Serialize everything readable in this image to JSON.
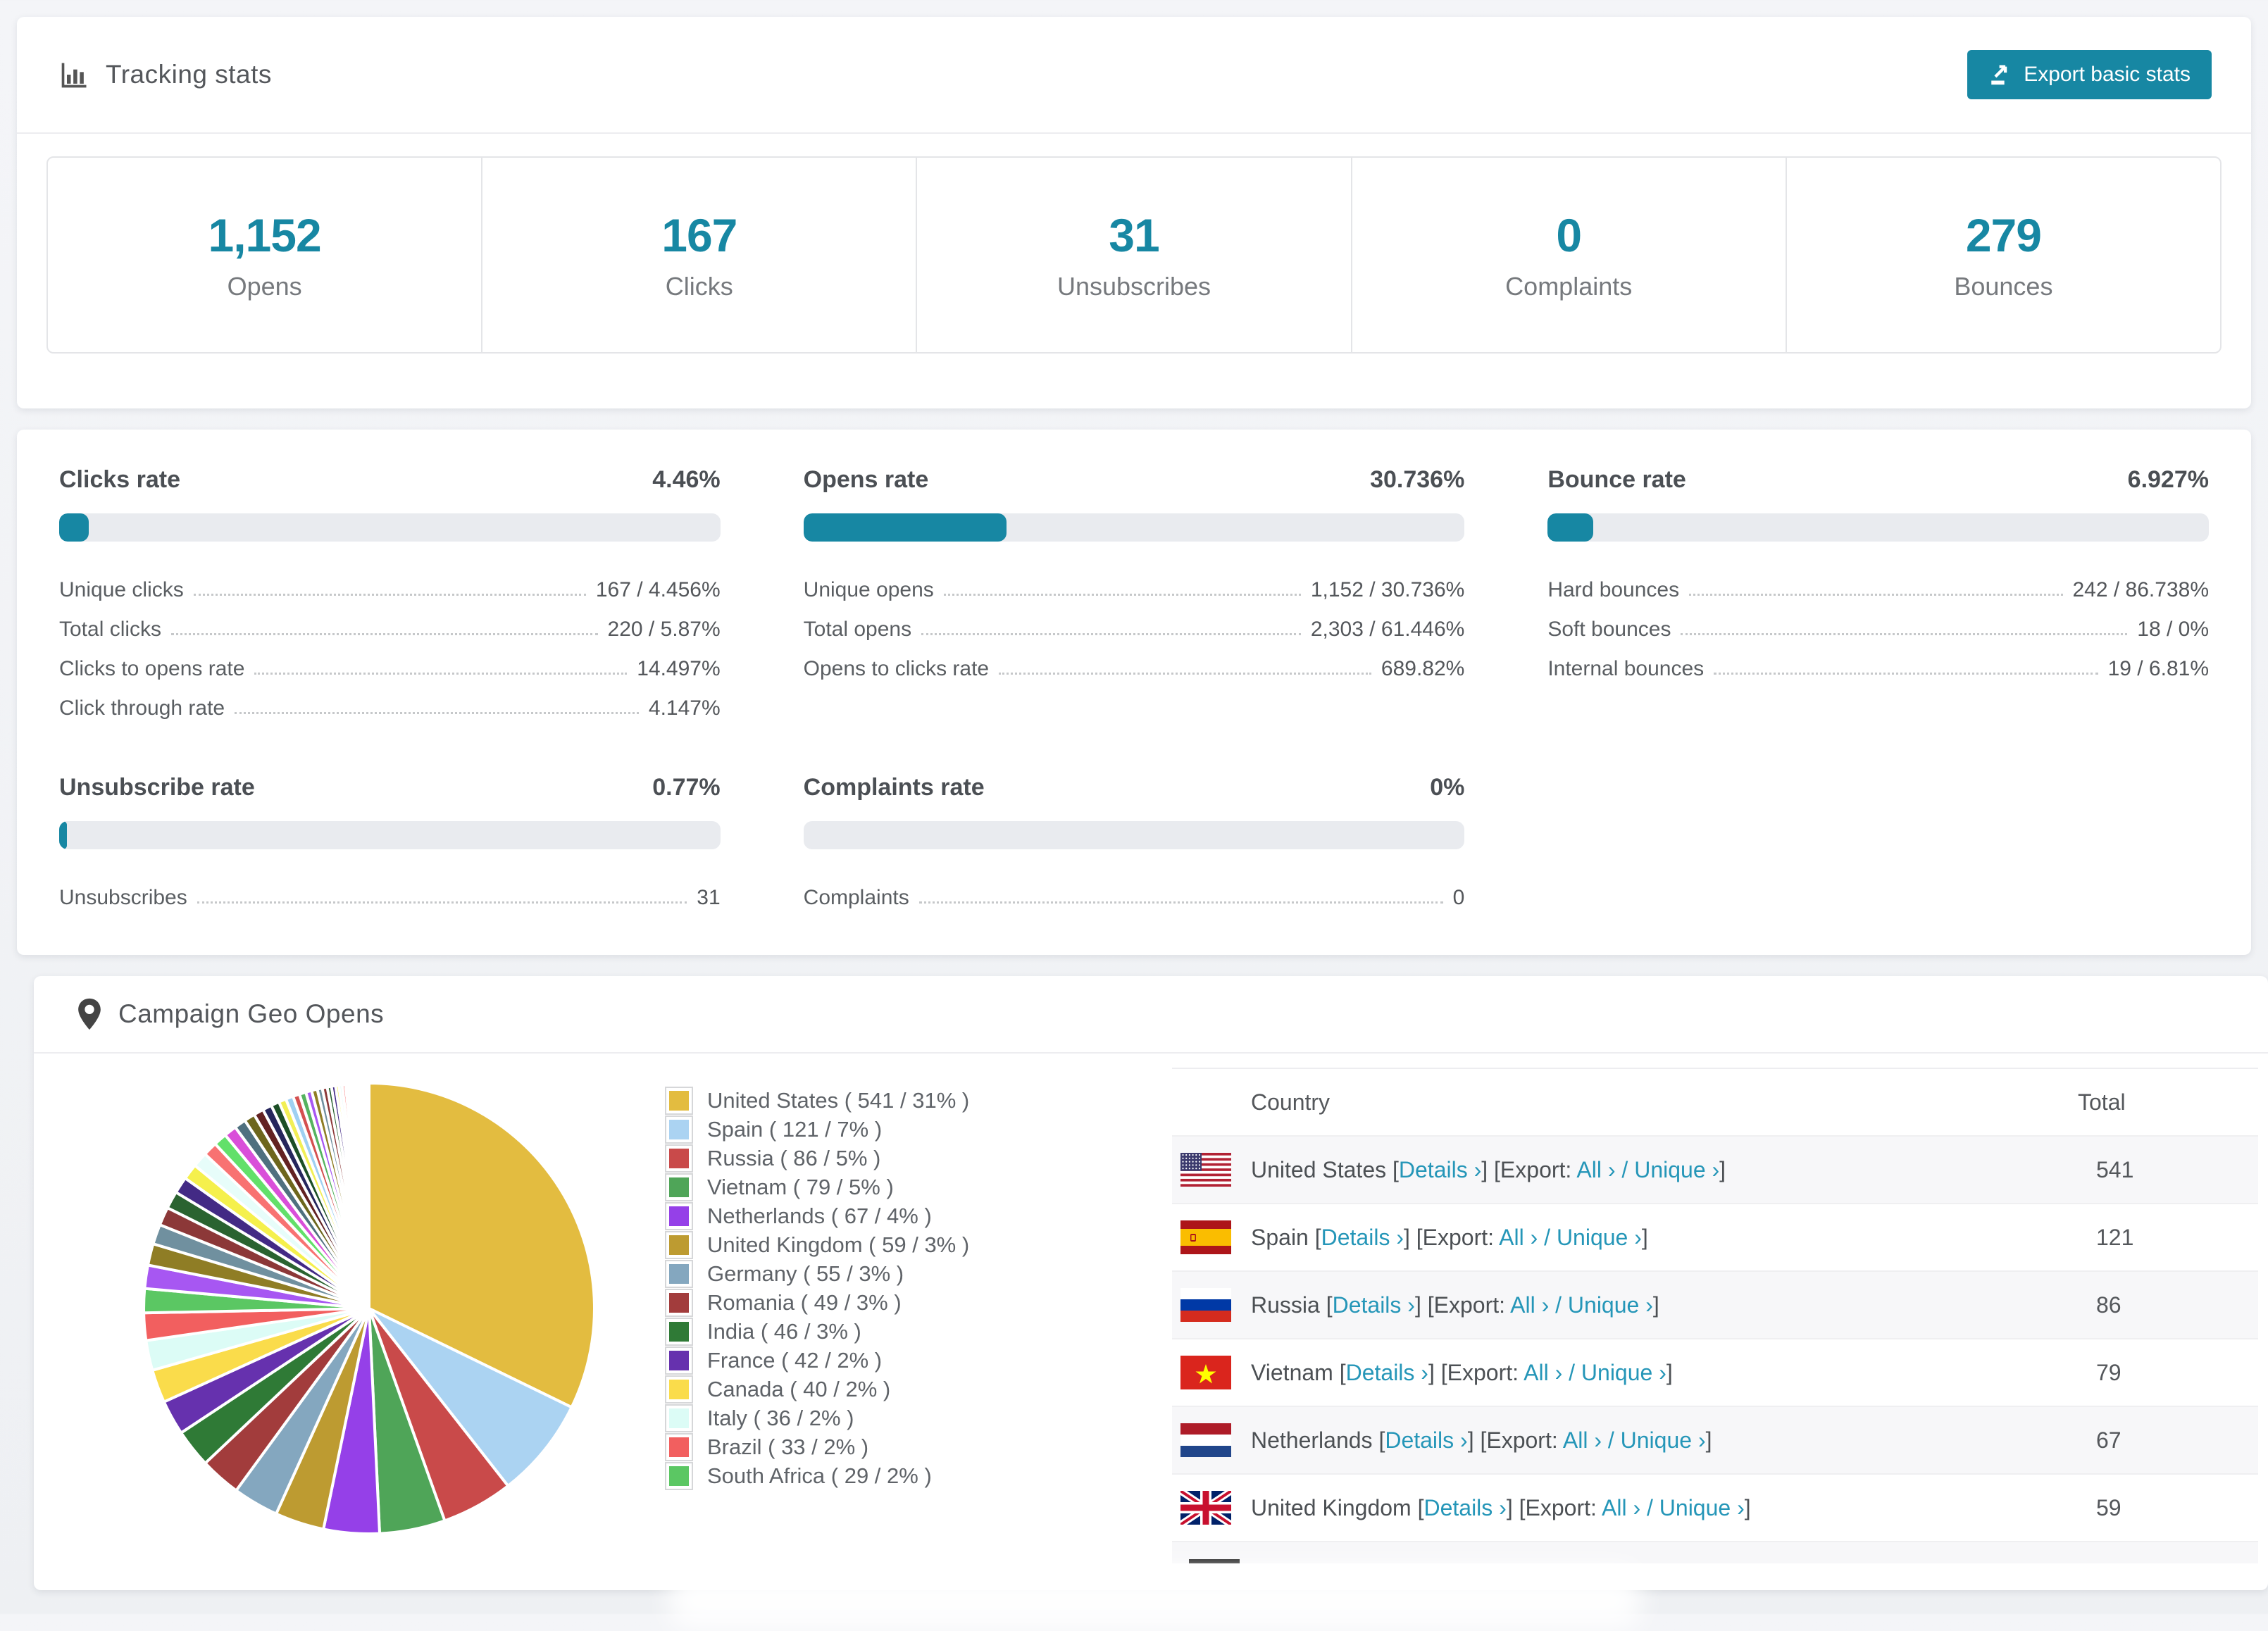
{
  "colors": {
    "accent": "#1787a3",
    "link": "#2596b8",
    "bar_bg": "#e9ebef",
    "swatch_palette": [
      "#e3bc40",
      "#abd3f2",
      "#c94a4a",
      "#4fa558",
      "#9540e8",
      "#bd9b31",
      "#84a7bf",
      "#a23c3c",
      "#2f7a36",
      "#6631ae",
      "#fadc4b",
      "#dcfcf6",
      "#f25f5f",
      "#5bc763"
    ],
    "tail_palette": [
      "#a757f2",
      "#8f7d25",
      "#70909f",
      "#8c3838",
      "#2a6330",
      "#432a85",
      "#f5f04c",
      "#e7fdfa",
      "#f87272",
      "#62e06a",
      "#d94fd9",
      "#4f707f",
      "#6d661d",
      "#632222",
      "#26265c",
      "#1c4f26",
      "#f2ef55",
      "#9fd0f2",
      "#d45050",
      "#55b360"
    ]
  },
  "tracking": {
    "title": "Tracking stats",
    "export_label": "Export basic stats",
    "stats": [
      {
        "value": "1,152",
        "label": "Opens"
      },
      {
        "value": "167",
        "label": "Clicks"
      },
      {
        "value": "31",
        "label": "Unsubscribes"
      },
      {
        "value": "0",
        "label": "Complaints"
      },
      {
        "value": "279",
        "label": "Bounces"
      }
    ]
  },
  "rates": {
    "blocks": [
      {
        "title": "Clicks rate",
        "value": "4.46%",
        "pct": 4.46,
        "rows": [
          [
            "Unique clicks",
            "167 / 4.456%"
          ],
          [
            "Total clicks",
            "220 / 5.87%"
          ],
          [
            "Clicks to opens rate",
            "14.497%"
          ],
          [
            "Click through rate",
            "4.147%"
          ]
        ]
      },
      {
        "title": "Opens rate",
        "value": "30.736%",
        "pct": 30.736,
        "rows": [
          [
            "Unique opens",
            "1,152 / 30.736%"
          ],
          [
            "Total opens",
            "2,303 / 61.446%"
          ],
          [
            "Opens to clicks rate",
            "689.82%"
          ]
        ]
      },
      {
        "title": "Bounce rate",
        "value": "6.927%",
        "pct": 6.927,
        "rows": [
          [
            "Hard bounces",
            "242 / 86.738%"
          ],
          [
            "Soft bounces",
            "18 / 0%"
          ],
          [
            "Internal bounces",
            "19 / 6.81%"
          ]
        ]
      },
      {
        "title": "Unsubscribe rate",
        "value": "0.77%",
        "pct": 0.77,
        "rows": [
          [
            "Unsubscribes",
            "31"
          ]
        ]
      },
      {
        "title": "Complaints rate",
        "value": "0%",
        "pct": 0,
        "rows": [
          [
            "Complaints",
            "0"
          ]
        ]
      }
    ]
  },
  "geo": {
    "title": "Campaign Geo Opens",
    "table": {
      "headers": [
        "Country",
        "Total"
      ],
      "details_label": "Details ›",
      "export_label": "Export:",
      "all_label": "All ›",
      "unique_label": "Unique ›",
      "rows": [
        {
          "country": "United States",
          "flag": "us",
          "total": "541"
        },
        {
          "country": "Spain",
          "flag": "es",
          "total": "121"
        },
        {
          "country": "Russia",
          "flag": "ru",
          "total": "86"
        },
        {
          "country": "Vietnam",
          "flag": "vn",
          "total": "79"
        },
        {
          "country": "Netherlands",
          "flag": "nl",
          "total": "67"
        },
        {
          "country": "United Kingdom",
          "flag": "gb",
          "total": "59"
        }
      ],
      "partial_row_flag": "de"
    }
  },
  "chart_data": {
    "type": "pie",
    "title": "Campaign Geo Opens",
    "legend_position": "right",
    "categories": [
      "United States",
      "Spain",
      "Russia",
      "Vietnam",
      "Netherlands",
      "United Kingdom",
      "Germany",
      "Romania",
      "India",
      "France",
      "Canada",
      "Italy",
      "Brazil",
      "South Africa"
    ],
    "values": [
      541,
      121,
      86,
      79,
      67,
      59,
      55,
      49,
      46,
      42,
      40,
      36,
      33,
      29
    ],
    "percent_labels": [
      31,
      7,
      5,
      5,
      4,
      3,
      3,
      3,
      3,
      2,
      2,
      2,
      2,
      2
    ],
    "other_slices_estimated": [
      28,
      26,
      24,
      22,
      21,
      20,
      19,
      18,
      17,
      16,
      15,
      14,
      13,
      12,
      11,
      10,
      9,
      9,
      8,
      8,
      7,
      7,
      6,
      6,
      5,
      5,
      4,
      4,
      4,
      3,
      3,
      3,
      2,
      2,
      2,
      2,
      2,
      2,
      1,
      1,
      1,
      1,
      1,
      1,
      1
    ]
  }
}
